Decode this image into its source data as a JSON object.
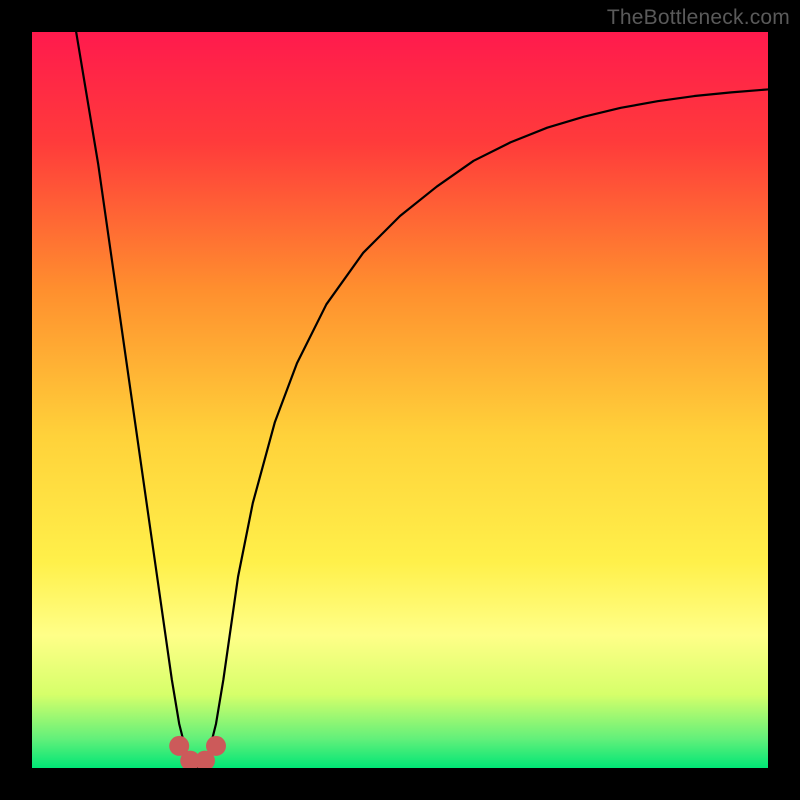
{
  "watermark": "TheBottleneck.com",
  "chart_data": {
    "type": "line",
    "title": "",
    "xlabel": "",
    "ylabel": "",
    "xlim": [
      0,
      100
    ],
    "ylim": [
      0,
      100
    ],
    "grid": false,
    "legend": false,
    "annotations": [],
    "gradient_stops": [
      {
        "offset": 0.0,
        "color": "#ff1a4d"
      },
      {
        "offset": 0.15,
        "color": "#ff3b3b"
      },
      {
        "offset": 0.35,
        "color": "#ff8f2e"
      },
      {
        "offset": 0.55,
        "color": "#ffd23a"
      },
      {
        "offset": 0.72,
        "color": "#fff04a"
      },
      {
        "offset": 0.82,
        "color": "#ffff88"
      },
      {
        "offset": 0.9,
        "color": "#d6ff6a"
      },
      {
        "offset": 0.96,
        "color": "#63f07a"
      },
      {
        "offset": 1.0,
        "color": "#00e676"
      }
    ],
    "series": [
      {
        "name": "bottleneck-curve",
        "stroke": "#000000",
        "stroke_width": 2.2,
        "x": [
          6,
          7,
          8,
          9,
          10,
          11,
          12,
          13,
          14,
          15,
          16,
          17,
          18,
          19,
          20,
          21,
          22,
          23,
          24,
          25,
          26,
          27,
          28,
          30,
          33,
          36,
          40,
          45,
          50,
          55,
          60,
          65,
          70,
          75,
          80,
          85,
          90,
          95,
          100
        ],
        "values": [
          100,
          94,
          88,
          82,
          75,
          68,
          61,
          54,
          47,
          40,
          33,
          26,
          19,
          12,
          6,
          2,
          0,
          0,
          2,
          6,
          12,
          19,
          26,
          36,
          47,
          55,
          63,
          70,
          75,
          79,
          82.5,
          85,
          87,
          88.5,
          89.7,
          90.6,
          91.3,
          91.8,
          92.2
        ]
      }
    ],
    "markers": {
      "name": "min-markers",
      "fill": "#cc5a5a",
      "radius": 10,
      "points": [
        {
          "x": 20.0,
          "y": 3
        },
        {
          "x": 21.5,
          "y": 1
        },
        {
          "x": 23.5,
          "y": 1
        },
        {
          "x": 25.0,
          "y": 3
        }
      ]
    }
  }
}
